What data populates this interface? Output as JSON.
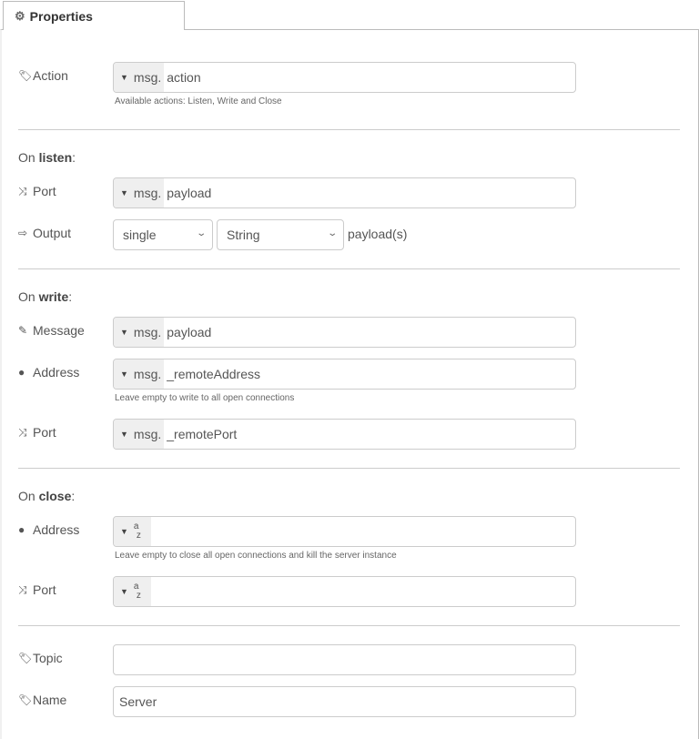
{
  "tab": {
    "label": "Properties",
    "icon": "gear-icon"
  },
  "action": {
    "label": "Action",
    "icon": "tag-icon",
    "type_label": "msg.",
    "value": "action",
    "help": "Available actions: Listen, Write and Close"
  },
  "listen": {
    "heading_prefix": "On ",
    "heading_bold": "listen",
    "heading_suffix": ":",
    "port": {
      "label": "Port",
      "icon": "random-icon",
      "type_label": "msg.",
      "value": "payload"
    },
    "output": {
      "label": "Output",
      "icon": "sign-out-icon",
      "mode_selected": "single",
      "format_selected": "String",
      "suffix": "payload(s)"
    }
  },
  "write": {
    "heading_prefix": "On ",
    "heading_bold": "write",
    "heading_suffix": ":",
    "message": {
      "label": "Message",
      "icon": "pencil-icon",
      "type_label": "msg.",
      "value": "payload"
    },
    "address": {
      "label": "Address",
      "icon": "globe-icon",
      "type_label": "msg.",
      "value": "_remoteAddress",
      "help": "Leave empty to write to all open connections"
    },
    "port": {
      "label": "Port",
      "icon": "random-icon",
      "type_label": "msg.",
      "value": "_remotePort"
    }
  },
  "close": {
    "heading_prefix": "On ",
    "heading_bold": "close",
    "heading_suffix": ":",
    "address": {
      "label": "Address",
      "icon": "globe-icon",
      "type_label_top": "a",
      "type_label_bottom": "z",
      "value": "",
      "help": "Leave empty to close all open connections and kill the server instance"
    },
    "port": {
      "label": "Port",
      "icon": "random-icon",
      "type_label_top": "a",
      "type_label_bottom": "z",
      "value": ""
    }
  },
  "topic": {
    "label": "Topic",
    "icon": "tags-icon",
    "value": ""
  },
  "name": {
    "label": "Name",
    "icon": "tag-icon",
    "value": "Server"
  }
}
